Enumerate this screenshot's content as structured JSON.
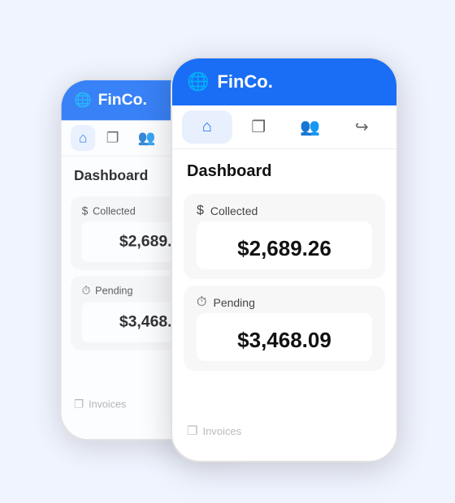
{
  "app": {
    "brand": "FinCo.",
    "logo_unicode": "🌐"
  },
  "nav": {
    "items": [
      {
        "id": "home",
        "icon": "⌂",
        "active": true
      },
      {
        "id": "documents",
        "icon": "❐",
        "active": false
      },
      {
        "id": "users",
        "icon": "👥",
        "active": false
      },
      {
        "id": "logout",
        "icon": "↪",
        "active": false
      }
    ]
  },
  "dashboard": {
    "title": "Dashboard",
    "collected": {
      "label": "Collected",
      "icon": "$",
      "value": "$2,689.26"
    },
    "pending": {
      "label": "Pending",
      "icon": "⏱",
      "value": "$3,468.09"
    },
    "invoices_label": "Invoices"
  },
  "colors": {
    "brand_blue": "#1a6ef5",
    "nav_active_bg": "#e8f0fe"
  }
}
